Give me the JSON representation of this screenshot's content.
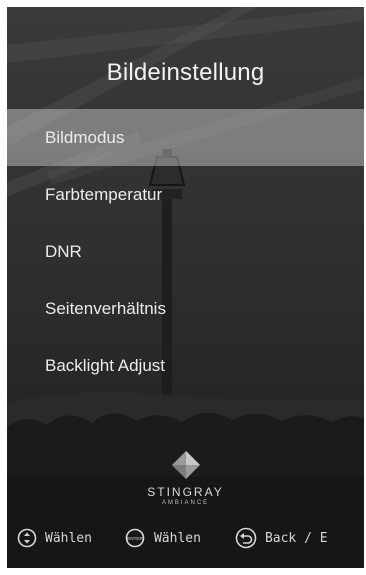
{
  "header": {
    "title": "Bildeinstellung"
  },
  "menu": {
    "items": [
      {
        "label": "Bildmodus",
        "selected": true
      },
      {
        "label": "Farbtemperatur",
        "selected": false
      },
      {
        "label": "DNR",
        "selected": false
      },
      {
        "label": "Seitenverhältnis",
        "selected": false
      },
      {
        "label": "Backlight Adjust",
        "selected": false
      }
    ]
  },
  "brand": {
    "name": "STINGRAY",
    "subtitle": "AMBIANCE",
    "logo_icon": "stingray-diamond-logo-icon"
  },
  "footer": {
    "hints": [
      {
        "icon": "navigate-updown-icon",
        "label": "Wählen"
      },
      {
        "icon": "enter-button-icon",
        "icon_text": "ENTER",
        "label": "Wählen"
      },
      {
        "icon": "back-arrow-icon",
        "label": "Back / E"
      }
    ]
  },
  "colors": {
    "text": "#ececec",
    "selection": "#8c8c8c"
  }
}
